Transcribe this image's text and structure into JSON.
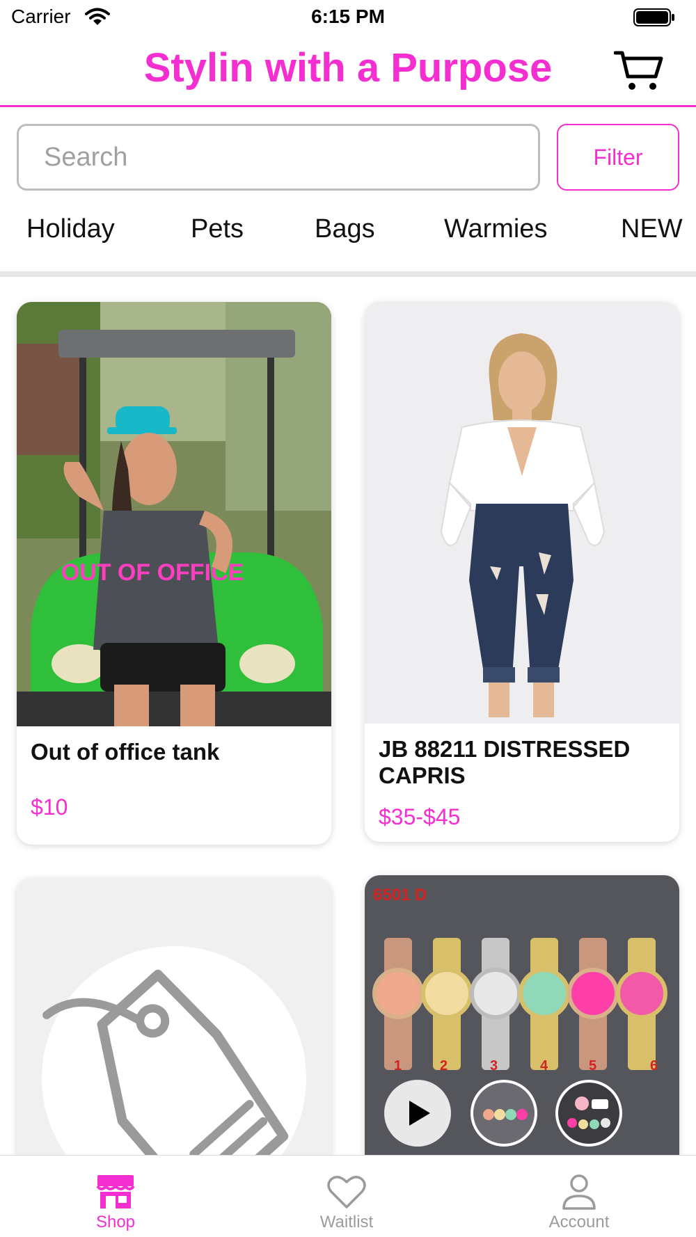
{
  "status_bar": {
    "carrier": "Carrier",
    "time": "6:15 PM"
  },
  "header": {
    "title": "Stylin with a Purpose"
  },
  "search": {
    "placeholder": "Search",
    "filter_label": "Filter"
  },
  "categories": [
    "Holiday",
    "Pets",
    "Bags",
    "Warmies",
    "NEW"
  ],
  "products": [
    {
      "title": "Out of office tank",
      "price": "$10",
      "image_text": "OUT OF OFFICE"
    },
    {
      "title": "JB 88211 DISTRESSED CAPRIS",
      "price": "$35-$45"
    },
    {
      "title": "",
      "price": ""
    },
    {
      "title": "",
      "price": "",
      "image_code": "6501 D",
      "image_numbers": [
        "1",
        "2",
        "3",
        "4",
        "5",
        "6"
      ]
    }
  ],
  "tabs": [
    {
      "label": "Shop",
      "icon": "shop-icon",
      "active": true
    },
    {
      "label": "Waitlist",
      "icon": "heart-icon",
      "active": false
    },
    {
      "label": "Account",
      "icon": "person-icon",
      "active": false
    }
  ],
  "colors": {
    "accent": "#f52ed1",
    "muted": "#9b9b9b",
    "border": "#bdbdbd"
  }
}
